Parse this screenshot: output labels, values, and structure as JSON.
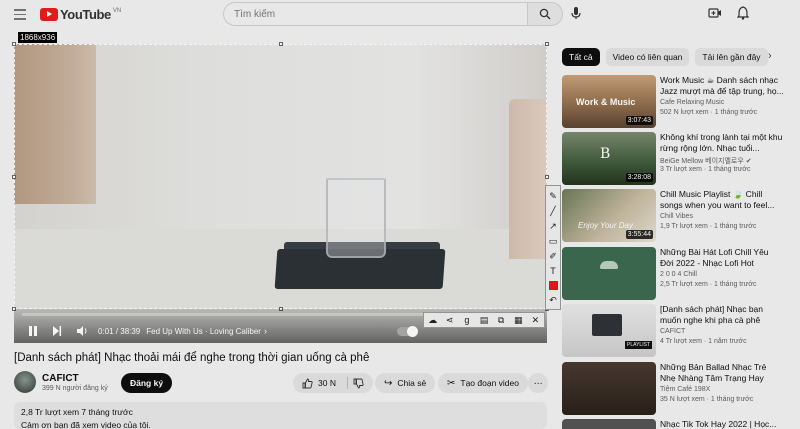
{
  "header": {
    "logo_word": "YouTube",
    "logo_region": "VN",
    "search_placeholder": "Tìm kiếm"
  },
  "capture": {
    "size_label": "1868x936"
  },
  "player": {
    "time": "0:01 / 38:39",
    "chapter": "Fed Up With Us · Loving Caliber",
    "progress": 0.0
  },
  "video": {
    "title": "[Danh sách phát] Nhạc thoải mái để nghe trong thời gian uống cà phê",
    "channel": "CAFICT",
    "subscribers": "399 N người đăng ký",
    "subscribe_label": "Đăng ký",
    "likes": "30 N",
    "share_label": "Chia sẻ",
    "clip_label": "Tạo đoạn video",
    "views_line": "2,8 Tr lượt xem  7 tháng trước",
    "desc_line": "Cảm ơn bạn đã xem video của tôi."
  },
  "chips": [
    "Tất cả",
    "Video có liên quan",
    "Tải lên gần đây"
  ],
  "recommendations": [
    {
      "title": "Work Music ☕ Danh sách nhạc Jazz mượt mà để tập trung, họ...",
      "channel": "Cafe Relaxing Music",
      "meta": "502 N lượt xem · 1 tháng trước",
      "duration": "3:07:43",
      "thumb_text": "Work & Music"
    },
    {
      "title": "Không khí trong lành tại một khu rừng rộng lớn. Nhạc tuổi...",
      "channel": "BeiGe Mellow 베이지멜로우 ✔",
      "meta": "3 Tr lượt xem · 1 tháng trước",
      "duration": "3:28:08",
      "thumb_text": "B"
    },
    {
      "title": "Chill Music Playlist 🍃 Chill songs when you want to feel...",
      "channel": "Chill Vibes",
      "meta": "1,9 Tr lượt xem · 1 tháng trước",
      "duration": "3:55:44",
      "thumb_text": "Enjoy Your Day"
    },
    {
      "title": "Những Bài Hát Lofi Chill Yêu Đời 2022 - Nhạc Lofi Hot TikTok...",
      "channel": "2 0 0 4 Chill",
      "meta": "2,5 Tr lượt xem · 1 tháng trước",
      "duration": "",
      "thumb_text": ""
    },
    {
      "title": "[Danh sách phát] Nhạc bạn muốn nghe khi pha cà phê",
      "channel": "CAFICT",
      "meta": "4 Tr lượt xem · 1 năm trước",
      "duration": "",
      "thumb_text": "PLAYLIST"
    },
    {
      "title": "Những Bản Ballad Nhạc Trẻ Nhẹ Nhàng Tâm Trạng Hay Nhất...",
      "channel": "Tiệm Café 198X",
      "meta": "35 N lượt xem · 1 tháng trước",
      "duration": "",
      "thumb_text": ""
    },
    {
      "title": "Nhạc Tik Tok Hay 2022 | Học...",
      "channel": "",
      "meta": "",
      "duration": "",
      "thumb_text": ""
    }
  ],
  "colors": {
    "brand_red": "#e61e1e",
    "chip_active": "#0f0f0f"
  }
}
